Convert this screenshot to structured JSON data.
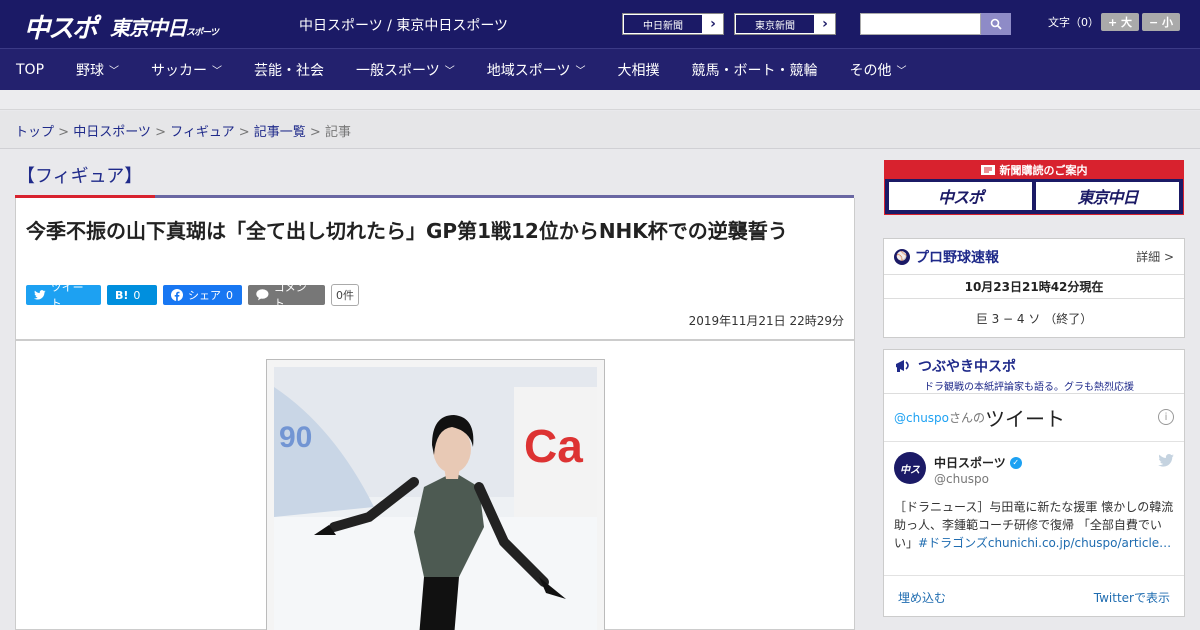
{
  "header": {
    "logo_main": "中スポ",
    "logo_tokyo": "東京中日",
    "logo_tokyo_small": "スポーツ",
    "site_name": "中日スポーツ / 東京中日スポーツ",
    "links": [
      {
        "label": "中日新聞",
        "arrow": "›"
      },
      {
        "label": "東京新聞",
        "arrow": "›"
      }
    ],
    "search_placeholder": "",
    "font_label": "文字（0）",
    "font_plus": "+ 大",
    "font_minus": "− 小"
  },
  "nav": {
    "items": [
      {
        "label": "TOP",
        "chev": ""
      },
      {
        "label": "野球",
        "chev": "﹀"
      },
      {
        "label": "サッカー",
        "chev": "﹀"
      },
      {
        "label": "芸能・社会",
        "chev": ""
      },
      {
        "label": "一般スポーツ",
        "chev": "﹀"
      },
      {
        "label": "地域スポーツ",
        "chev": "﹀"
      },
      {
        "label": "大相撲",
        "chev": ""
      },
      {
        "label": "競馬・ボート・競輪",
        "chev": ""
      },
      {
        "label": "その他",
        "chev": "﹀"
      }
    ]
  },
  "breadcrumb": {
    "items": [
      "トップ",
      "中日スポーツ",
      "フィギュア",
      "記事一覧"
    ],
    "sep": " > ",
    "current": "記事"
  },
  "article": {
    "category": "【フィギュア】",
    "headline": "今季不振の山下真瑚は「全て出し切れたら」GP第1戦12位からNHK杯での逆襲誓う",
    "share": {
      "tweet": "ツイート",
      "hatena": "B!",
      "hatena_count": "0",
      "facebook": "シェア",
      "facebook_count": "0",
      "comment": "コメント",
      "comment_count": "0件"
    },
    "date": "2019年11月21日 22時29分"
  },
  "sidebar": {
    "subscribe_title": "新聞購読のご案内",
    "subscribe_buttons": [
      "中スポ",
      "東京中日"
    ],
    "baseball": {
      "title": "プロ野球速報",
      "more": "詳細 >",
      "updated": "10月23日21時42分現在",
      "score": "巨 3 − 4 ソ （終了）"
    },
    "tsubuyaki": {
      "title": "つぶやき中スポ",
      "subtitle": "ドラ観戦の本紙評論家も語る。グラも熱烈応援",
      "tweets_handle": "@chuspo",
      "tweets_suffix": "さんの",
      "tweets_title": "ツイート",
      "info": "i",
      "tweet": {
        "name": "中日スポーツ",
        "handle": "@chuspo",
        "text": "［ドラニュース］与田竜に新たな援軍 懐かしの韓流助っ人、李鍾範コーチ研修で復帰 「全部自費でいい」",
        "tag": "#ドラゴンズ",
        "link": "chunichi.co.jp/chuspo/article…"
      },
      "embed": "埋め込む",
      "view": "Twitterで表示"
    }
  }
}
